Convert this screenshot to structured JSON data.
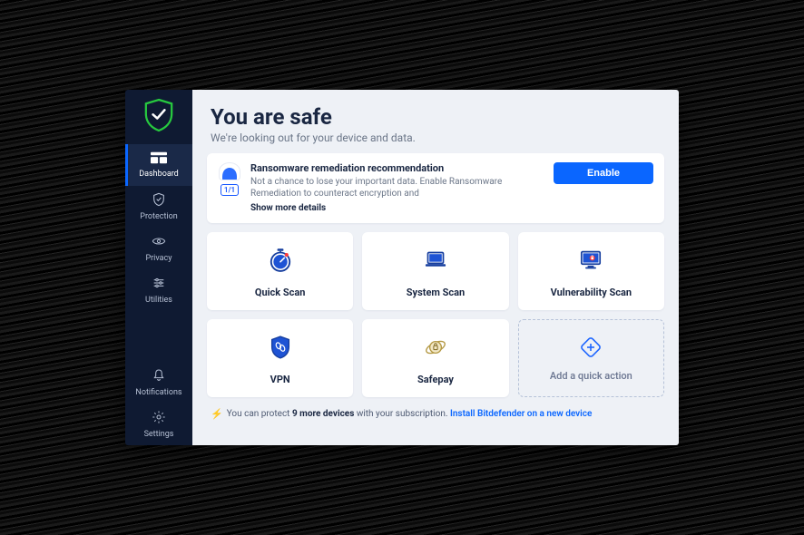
{
  "sidebar": {
    "items": [
      {
        "label": "Dashboard"
      },
      {
        "label": "Protection"
      },
      {
        "label": "Privacy"
      },
      {
        "label": "Utilities"
      },
      {
        "label": "Notifications"
      },
      {
        "label": "Settings"
      }
    ]
  },
  "header": {
    "title": "You are safe",
    "subtitle": "We're looking out for your device and data."
  },
  "recommendation": {
    "counter": "1/1",
    "title": "Ransomware remediation recommendation",
    "body": "Not a chance to lose your important data. Enable Ransomware Remediation to counteract encryption and",
    "more": "Show more details",
    "button": "Enable"
  },
  "tiles": [
    {
      "label": "Quick Scan"
    },
    {
      "label": "System Scan"
    },
    {
      "label": "Vulnerability Scan"
    },
    {
      "label": "VPN"
    },
    {
      "label": "Safepay"
    },
    {
      "label": "Add a quick action"
    }
  ],
  "footer": {
    "prefix": "You can protect ",
    "count": "9 more devices",
    "middle": " with your subscription. ",
    "link": "Install Bitdefender on a new device"
  }
}
